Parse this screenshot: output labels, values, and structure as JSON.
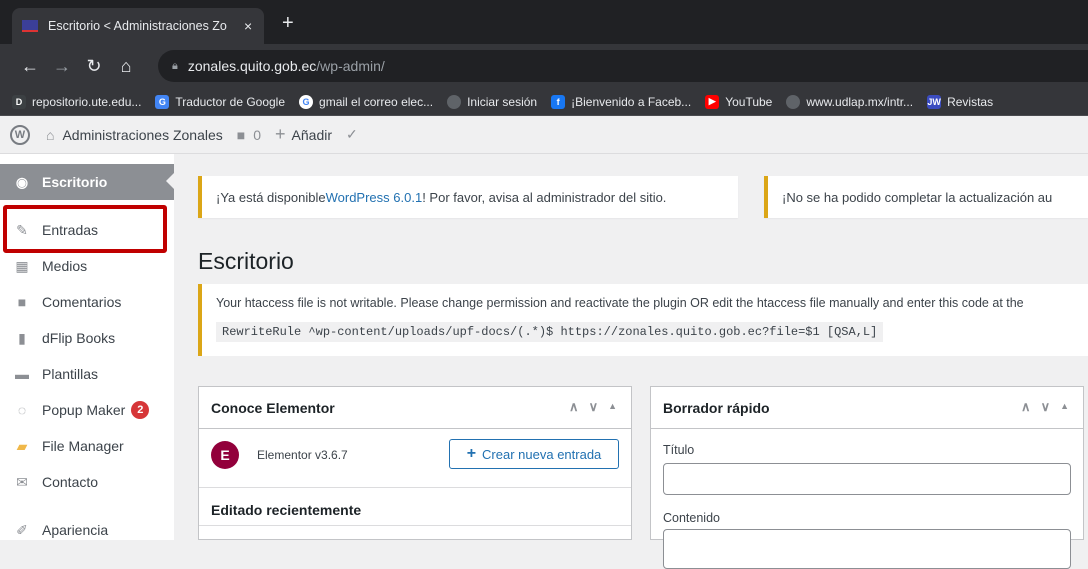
{
  "browser": {
    "tab_title": "Escritorio < Administraciones Zo",
    "tab_close": "×",
    "new_tab": "+",
    "url_host": "zonales.quito.gob.ec",
    "url_path": "/wp-admin/",
    "bookmarks": [
      {
        "label": "repositorio.ute.edu...",
        "icon": "D",
        "color": "#3c4043"
      },
      {
        "label": "Traductor de Google",
        "icon": "G",
        "color": "#4285f4"
      },
      {
        "label": "gmail el correo elec...",
        "icon": "G",
        "color": "#ffffff"
      },
      {
        "label": "Iniciar sesión",
        "icon": "",
        "color": "#5f6368"
      },
      {
        "label": "¡Bienvenido a Faceb...",
        "icon": "f",
        "color": "#1877f2"
      },
      {
        "label": "YouTube",
        "icon": "▶",
        "color": "#ff0000"
      },
      {
        "label": "www.udlap.mx/intr...",
        "icon": "",
        "color": "#5f6368"
      },
      {
        "label": "Revistas",
        "icon": "JW",
        "color": "#3b4cc0"
      }
    ]
  },
  "adminbar": {
    "site_name": "Administraciones Zonales",
    "comments_count": "0",
    "add_label": "Añadir"
  },
  "sidebar": {
    "items": [
      {
        "label": "Escritorio",
        "icon": "dashboard-icon",
        "glyph": "◉"
      },
      {
        "label": "Entradas",
        "icon": "pin-icon",
        "glyph": "✎"
      },
      {
        "label": "Medios",
        "icon": "media-icon",
        "glyph": "▦"
      },
      {
        "label": "Comentarios",
        "icon": "comments-icon",
        "glyph": "■"
      },
      {
        "label": "dFlip Books",
        "icon": "book-icon",
        "glyph": "▮"
      },
      {
        "label": "Plantillas",
        "icon": "folder-icon",
        "glyph": "▬"
      },
      {
        "label": "Popup Maker",
        "icon": "popup-icon",
        "glyph": "◌",
        "badge": "2"
      },
      {
        "label": "File Manager",
        "icon": "file-manager-icon",
        "glyph": "▰"
      },
      {
        "label": "Contacto",
        "icon": "mail-icon",
        "glyph": "✉"
      },
      {
        "label": "Apariencia",
        "icon": "appearance-icon",
        "glyph": "✐"
      }
    ]
  },
  "notices": {
    "update_pre": "¡Ya está disponible ",
    "update_link": "WordPress 6.0.1",
    "update_post": "! Por favor, avisa al administrador del sitio.",
    "failed_update": "¡No se ha podido completar la actualización au",
    "htaccess_text": "Your htaccess file is not writable. Please change permission and reactivate the plugin OR edit the htaccess file manually and enter this code at the",
    "htaccess_code": "RewriteRule ^wp-content/uploads/upf-docs/(.*)$ https://zonales.quito.gob.ec?file=$1 [QSA,L]"
  },
  "page_title": "Escritorio",
  "elementor_box": {
    "title": "Conoce Elementor",
    "version": "Elementor v3.6.7",
    "create_label": "Crear nueva entrada",
    "recent_label": "Editado recientemente"
  },
  "draft_box": {
    "title": "Borrador rápido",
    "title_label": "Título",
    "content_label": "Contenido"
  }
}
